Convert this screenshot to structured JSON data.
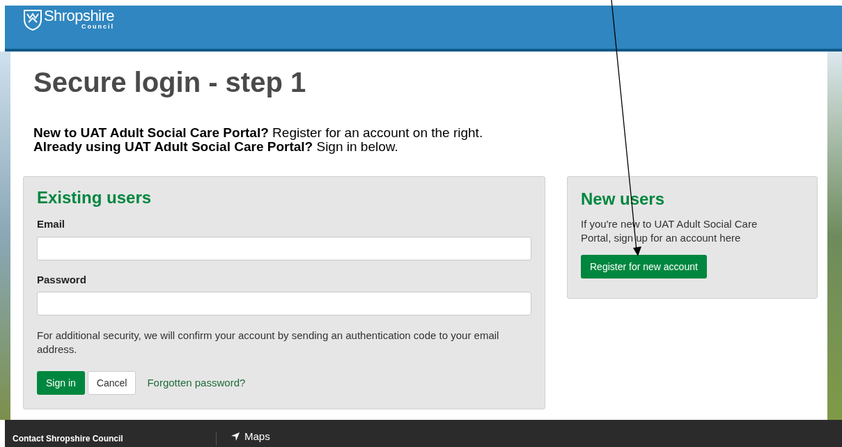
{
  "header": {
    "logo_text": "Shropshire",
    "logo_subtext": "Council"
  },
  "page": {
    "title": "Secure login - step 1",
    "intro": [
      "**New to UAT Adult Social Care Portal?** Register for an account on the right.",
      "**Already using UAT Adult Social Care Portal?** Sign in below."
    ]
  },
  "existing_users": {
    "heading": "Existing users",
    "fields": [
      {
        "label": "Email"
      },
      {
        "label": "Password"
      }
    ],
    "note": "For additional security, we will confirm your account by sending an authentication code to your email address.",
    "sign_in": "Sign in",
    "cancel": "Cancel",
    "forgotten": "Forgotten password?"
  },
  "new_users": {
    "heading": "New users",
    "text": "If you're new to UAT Adult Social Care Portal, sign up for an account here",
    "button": "Register for new account"
  },
  "footer": {
    "contact": "Contact Shropshire Council",
    "maps": "Maps"
  }
}
